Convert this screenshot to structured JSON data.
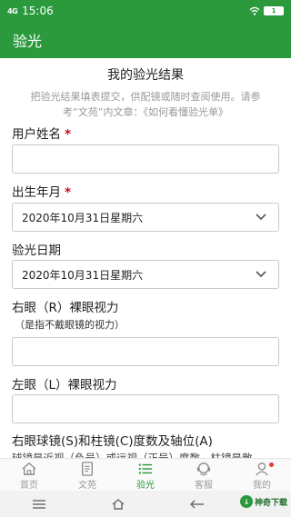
{
  "status": {
    "signal": "4G",
    "time": "15:06",
    "battery": "1"
  },
  "app_bar": {
    "title": "验光"
  },
  "main": {
    "section_title": "我的验光结果",
    "intro_line1": "把验光结果填表提交，供配镜或随时查阅使用。请参",
    "intro_line2": "考“文苑”内文章：《如何看懂验光单》",
    "fields": {
      "name_label": "用户姓名",
      "name_required": "*",
      "birth_label": "出生年月",
      "birth_required": "*",
      "birth_value": "2020年10月31日星期六",
      "exam_date_label": "验光日期",
      "exam_date_value": "2020年10月31日星期六",
      "right_eye_label": "右眼（R）裸眼视力",
      "right_eye_hint": "（是指不戴眼镜的视力）",
      "left_eye_label": "左眼（L）裸眼视力",
      "right_lens_label": "右眼球镜(S)和柱镜(C)度数及轴位(A)",
      "right_lens_hint_clipped": "球镜是近视（负号）或远视（正号）度数，柱镜是散"
    }
  },
  "tabs": [
    {
      "label": "首页",
      "icon": "home-icon"
    },
    {
      "label": "文苑",
      "icon": "document-icon"
    },
    {
      "label": "验光",
      "icon": "list-icon"
    },
    {
      "label": "客服",
      "icon": "headset-icon"
    },
    {
      "label": "我的",
      "icon": "user-icon"
    }
  ],
  "watermark": {
    "text": "神奇下载"
  },
  "colors": {
    "primary": "#2a9a3d",
    "required": "#d0021b",
    "badge": "#e53935"
  }
}
